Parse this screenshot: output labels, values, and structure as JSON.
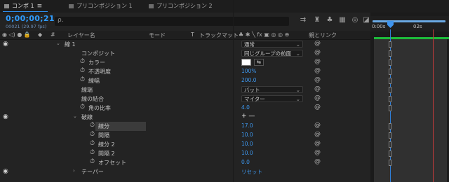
{
  "tabs": [
    {
      "label": "コンポ 1",
      "active": true
    },
    {
      "label": "プリコンポジション 1",
      "active": false
    },
    {
      "label": "プリコンポジション 2",
      "active": false
    }
  ],
  "timecode": "0;00;00;21",
  "fps_info": "00021 (29.97 fps)",
  "search": {
    "placeholder": "",
    "icon": "search-icon"
  },
  "header": {
    "layer_name": "レイヤー名",
    "mode": "モード",
    "t": "T",
    "trackmatte": "トラックマット",
    "parent_link": "親とリンク"
  },
  "timeline": {
    "tick_start": "0:00s",
    "tick_2s": "02s"
  },
  "rows": [
    {
      "label": "線 1",
      "value": "通常",
      "kind": "dropdown",
      "indent": 92
    },
    {
      "label": "コンポジット",
      "value": "同じグループの前面",
      "kind": "dropdown",
      "indent": 116
    },
    {
      "label": "カラー",
      "value": "",
      "kind": "color",
      "indent": 126
    },
    {
      "label": "不透明度",
      "value": "100%",
      "kind": "number",
      "indent": 126
    },
    {
      "label": "線幅",
      "value": "200.0",
      "kind": "number",
      "indent": 126
    },
    {
      "label": "線端",
      "value": "バット",
      "kind": "dropdown",
      "indent": 116
    },
    {
      "label": "線の結合",
      "value": "マイター",
      "kind": "dropdown",
      "indent": 116
    },
    {
      "label": "角の比率",
      "value": "4.0",
      "kind": "number",
      "indent": 126
    },
    {
      "label": "破線",
      "value": "+ —",
      "kind": "addremove",
      "indent": 116
    },
    {
      "label": "線分",
      "value": "17.0",
      "kind": "number",
      "indent": 140
    },
    {
      "label": "間隔",
      "value": "10.0",
      "kind": "number",
      "indent": 140
    },
    {
      "label": "線分 2",
      "value": "10.0",
      "kind": "number",
      "indent": 140
    },
    {
      "label": "間隔 2",
      "value": "10.0",
      "kind": "number",
      "indent": 140
    },
    {
      "label": "オフセット",
      "value": "0.0",
      "kind": "number",
      "indent": 140
    },
    {
      "label": "テーパー",
      "value": "リセット",
      "kind": "link",
      "indent": 116
    }
  ]
}
